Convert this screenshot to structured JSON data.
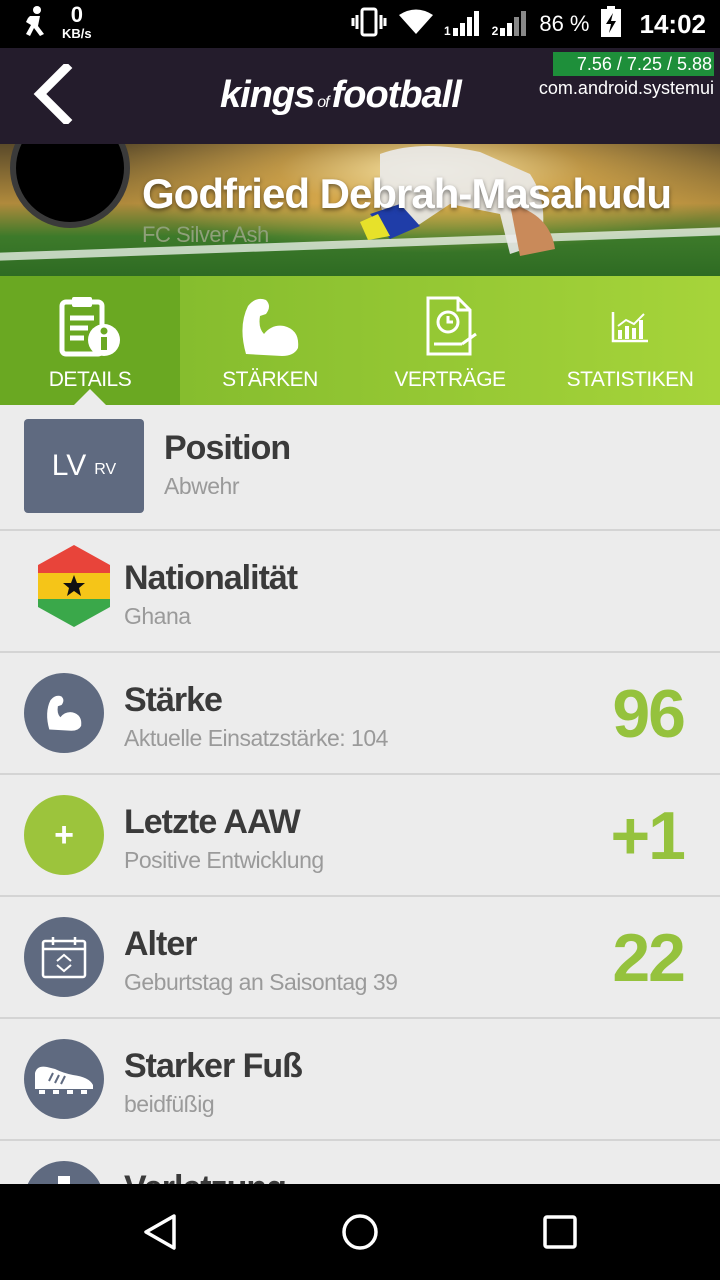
{
  "status_bar": {
    "net_speed": "0",
    "net_unit": "KB/s",
    "sim1": "1",
    "sim2": "2",
    "battery_percent": "86 %",
    "time": "14:02",
    "icons": [
      "person-icon",
      "vibrate-icon",
      "wifi-icon",
      "signal-icon",
      "battery-charging-icon"
    ]
  },
  "app_bar": {
    "logo_left": "kings",
    "logo_of": "of",
    "logo_right": "football",
    "debug_fps": "7.56 / 7.25 / 5.88",
    "debug_pkg": "com.android.systemui",
    "back_icon": "back-arrow-icon"
  },
  "player": {
    "name": "Godfried Debrah-Masahudu",
    "club": "FC Silver Ash"
  },
  "tabs": [
    {
      "label": "DETAILS",
      "icon": "details-icon",
      "active": true
    },
    {
      "label": "STÄRKEN",
      "icon": "muscle-icon",
      "active": false
    },
    {
      "label": "VERTRÄGE",
      "icon": "contract-icon",
      "active": false
    },
    {
      "label": "STATISTIKEN",
      "icon": "chart-icon",
      "active": false
    }
  ],
  "rows": {
    "position": {
      "badge_main": "LV",
      "badge_alt": "RV",
      "title": "Position",
      "sub": "Abwehr"
    },
    "nationality": {
      "title": "Nationalität",
      "sub": "Ghana",
      "flag_colors": [
        "#e8443a",
        "#f5c518",
        "#3aa84a"
      ]
    },
    "strength": {
      "title": "Stärke",
      "sub": "Aktuelle Einsatzstärke: 104",
      "value": "96"
    },
    "last_aaw": {
      "title": "Letzte AAW",
      "sub": "Positive Entwicklung",
      "value": "+1",
      "plus": "+"
    },
    "age": {
      "title": "Alter",
      "sub": "Geburtstag an Saisontag 39",
      "value": "22"
    },
    "foot": {
      "title": "Starker Fuß",
      "sub": "beidfüßig"
    },
    "injury": {
      "title": "Verletzung"
    }
  },
  "colors": {
    "accent_green": "#95c23d",
    "icon_circle": "#5f6a80",
    "app_bar": "#241c2c"
  }
}
